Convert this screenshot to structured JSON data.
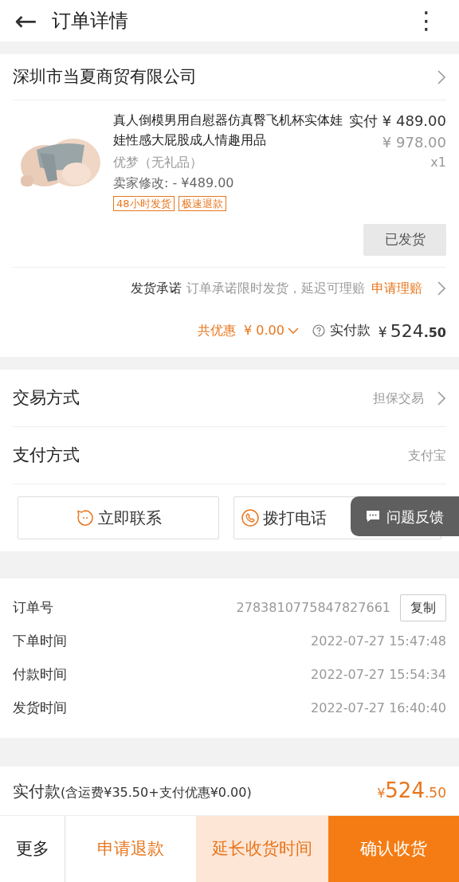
{
  "header": {
    "back": "←",
    "title": "订单详情",
    "more": "⋮"
  },
  "shop": {
    "name": "深圳市当夏商贸有限公司",
    "item": {
      "title": "真人倒模男用自慰器仿真臀飞机杯实体娃娃性感大屁股成人情趣用品",
      "paid_label": "实付",
      "price": "¥ 489.00",
      "original_price": "¥ 978.00",
      "sku": "优梦（无礼品）",
      "quantity": "x1",
      "seller_change": "卖家修改: - ¥489.00",
      "tags": [
        "48小时发货",
        "极速退款"
      ],
      "status_button": "已发货"
    },
    "promise": {
      "label": "发货承诺",
      "text": "订单承诺限时发货，延迟可理赔",
      "link": "申请理赔"
    },
    "discount_label": "共优惠",
    "discount": "¥ 0.00",
    "paid_label": "实付款",
    "paid_currency": "¥",
    "paid_int": "524",
    "paid_dec": ".50"
  },
  "settings": [
    {
      "label": "交易方式",
      "value": "担保交易",
      "chevron": true
    },
    {
      "label": "支付方式",
      "value": "支付宝",
      "chevron": false
    }
  ],
  "contact_buttons": [
    {
      "kind": "chat",
      "label": "立即联系"
    },
    {
      "kind": "phone",
      "label": "拨打电话"
    }
  ],
  "feedback": "问题反馈",
  "order_info": [
    {
      "label": "订单号",
      "value": "2783810775847827661",
      "action": "复制"
    },
    {
      "label": "下单时间",
      "value": "2022-07-27 15:47:48"
    },
    {
      "label": "付款时间",
      "value": "2022-07-27 15:54:34"
    },
    {
      "label": "发货时间",
      "value": "2022-07-27 16:40:40"
    }
  ],
  "total": {
    "label": "实付款",
    "note": "(含运费¥35.50+支付优惠¥0.00)",
    "currency": "¥",
    "int": "524",
    "dec": ".50"
  },
  "actions": [
    {
      "kind": "plain",
      "label": "更多"
    },
    {
      "kind": "outline",
      "label": "申请退款"
    },
    {
      "kind": "light",
      "label": "延长收货时间"
    },
    {
      "kind": "primary",
      "label": "确认收货"
    }
  ]
}
